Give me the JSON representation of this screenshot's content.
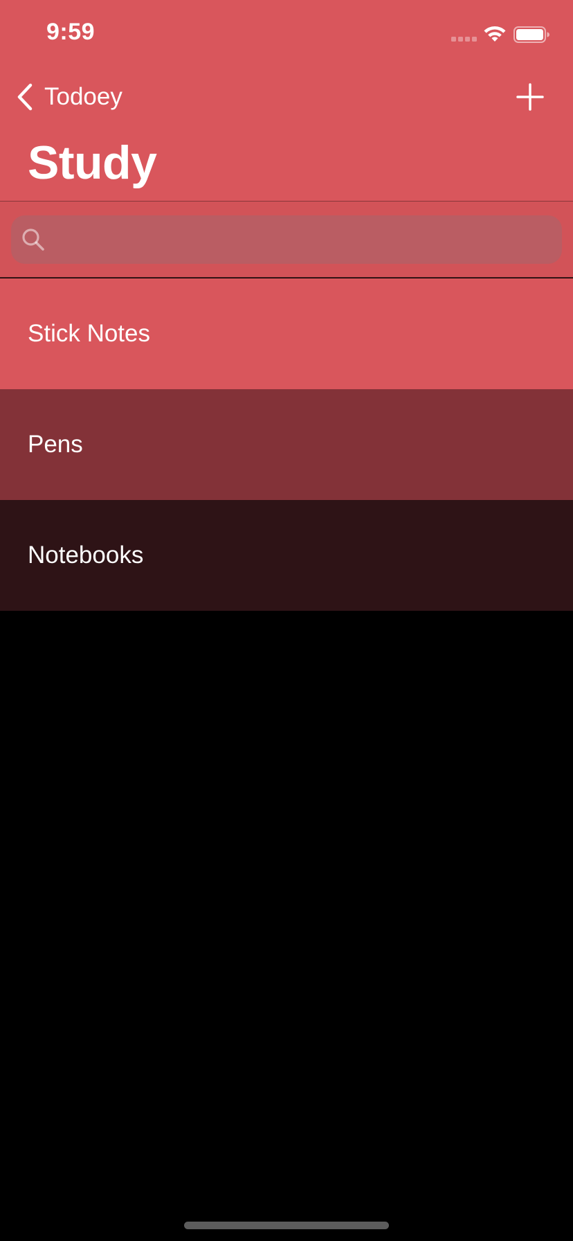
{
  "status_bar": {
    "time": "9:59"
  },
  "nav": {
    "back_label": "Todoey",
    "back_icon": "chevron-left-icon",
    "add_icon": "plus-icon"
  },
  "page": {
    "title": "Study"
  },
  "search": {
    "placeholder": "",
    "value": "",
    "icon": "search-icon"
  },
  "items": [
    {
      "label": "Stick Notes",
      "color": "#d9565c"
    },
    {
      "label": "Pens",
      "color": "#833238"
    },
    {
      "label": "Notebooks",
      "color": "#2e1316"
    }
  ],
  "colors": {
    "accent": "#d9565c",
    "background": "#000000",
    "text": "#ffffff"
  }
}
